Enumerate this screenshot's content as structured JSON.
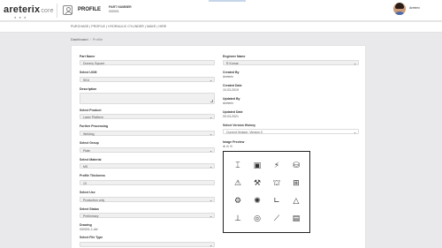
{
  "brand": {
    "name": "areterix",
    "suffix": "core"
  },
  "header": {
    "title": "PROFILE",
    "part_number_label": "PART NUMBER",
    "part_number_value": "000001",
    "user_name": "Areterix"
  },
  "nav": {
    "breadcrumb_text": "PURCHASE | PROFILE | HYDRAULIC CYLINDER | MAKE | HIRE"
  },
  "breadcrumb": {
    "root": "Dashboard",
    "current": "Profile"
  },
  "form": {
    "part_name": {
      "label": "Part Name",
      "value": "Dummy Square"
    },
    "select_uom": {
      "label": "Select UOM",
      "value": "SKU"
    },
    "description": {
      "label": "Description",
      "value": ""
    },
    "select_product": {
      "label": "Select Product",
      "value": "Laser Platform"
    },
    "further_processing": {
      "label": "Further Processing",
      "value": "Welding"
    },
    "select_group": {
      "label": "Select Group",
      "value": "Plate"
    },
    "select_material": {
      "label": "Select Material",
      "value": "MS"
    },
    "profile_thickness": {
      "label": "Profile Thickness",
      "value": "10"
    },
    "select_use": {
      "label": "Select Use",
      "value": "Production only"
    },
    "select_status": {
      "label": "Select Status",
      "value": "Preliminary"
    },
    "drawing": {
      "label": "Drawing",
      "value": "000001-1.dxf"
    },
    "select_file_type": {
      "label": "Select File Type",
      "value": ""
    },
    "engineer_name": {
      "label": "Engineer Name",
      "value": "R Kumar"
    },
    "created_by": {
      "label": "Created By",
      "value": "Areterix"
    },
    "created_date": {
      "label": "Created Date",
      "value": "10-03-2019"
    },
    "updated_by": {
      "label": "Updated By",
      "value": "Areterix"
    },
    "updated_date": {
      "label": "Updated Date",
      "value": "09-03-2021"
    },
    "version_history": {
      "label": "Select Version History",
      "value": "Current Version: Version 0"
    },
    "image_preview": {
      "label": "Image Preview"
    }
  },
  "preview_tools": [
    "zoom-in-icon",
    "zoom-out-icon",
    "reset-icon"
  ],
  "preview_icons": [
    "steel-beam-icon",
    "frame-icon",
    "laser-cut-icon",
    "tank-icon",
    "warning-icon",
    "robot-arm-icon",
    "press-machine-icon",
    "gear-box-icon",
    "assembly-icon",
    "gear-icon",
    "axis-icon",
    "mountain-icon",
    "rail-icon",
    "disc-icon",
    "welding-torch-icon",
    "machine-bed-icon"
  ],
  "colors": {
    "accent": "#c6d6ea",
    "background": "#e9e9ec",
    "card": "#ffffff"
  }
}
